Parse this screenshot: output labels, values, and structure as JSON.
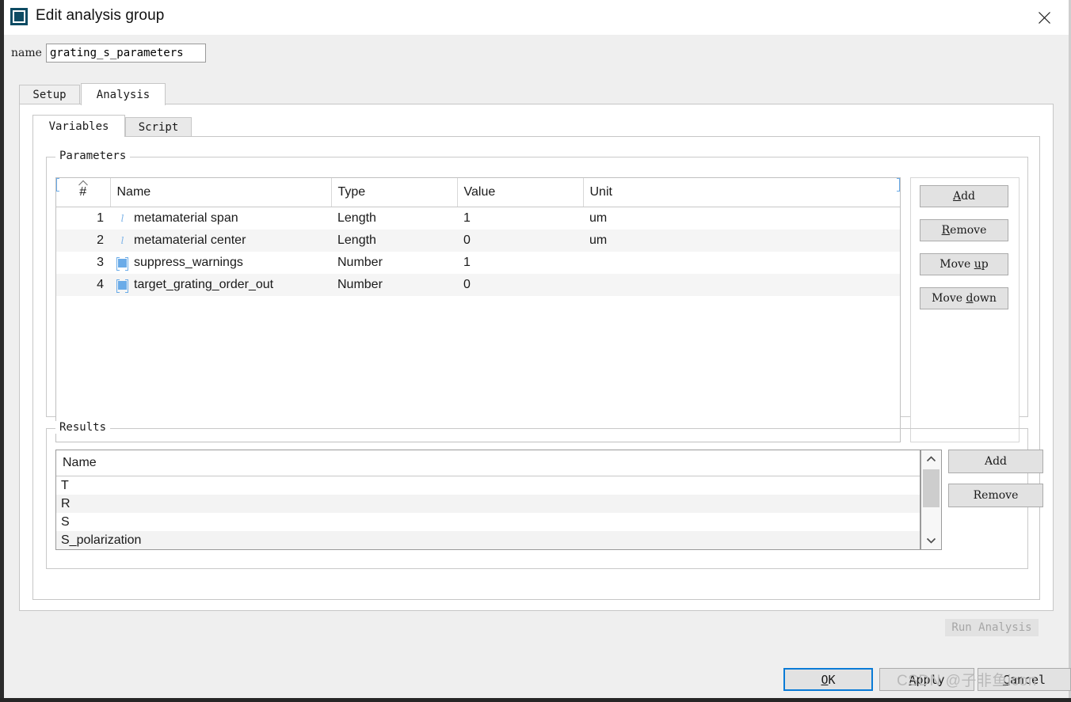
{
  "window": {
    "title": "Edit analysis group",
    "icon": "analysis-group-icon",
    "close_icon": "close-icon"
  },
  "name_field": {
    "label": "name",
    "value": "grating_s_parameters",
    "placeholder": ""
  },
  "tabs": [
    {
      "label": "Setup",
      "active": false
    },
    {
      "label": "Analysis",
      "active": true
    }
  ],
  "inner_tabs": [
    {
      "label": "Variables",
      "active": true
    },
    {
      "label": "Script",
      "active": false
    }
  ],
  "parameters": {
    "group_label": "Parameters",
    "columns": [
      "#",
      "Name",
      "Type",
      "Value",
      "Unit"
    ],
    "sort_indicator": "ascending",
    "rows": [
      {
        "num": "1",
        "icon": "length-variable-icon",
        "name": "metamaterial span",
        "type": "Length",
        "value": "1",
        "unit": "um"
      },
      {
        "num": "2",
        "icon": "length-variable-icon",
        "name": "metamaterial center",
        "type": "Length",
        "value": "0",
        "unit": "um"
      },
      {
        "num": "3",
        "icon": "number-variable-icon",
        "name": "suppress_warnings",
        "type": "Number",
        "value": "1",
        "unit": ""
      },
      {
        "num": "4",
        "icon": "number-variable-icon",
        "name": "target_grating_order_out",
        "type": "Number",
        "value": "0",
        "unit": ""
      }
    ],
    "buttons": [
      {
        "label": "Add",
        "mnemonic": "A"
      },
      {
        "label": "Remove",
        "mnemonic": "R"
      },
      {
        "label": "Move up",
        "mnemonic": "u"
      },
      {
        "label": "Move down",
        "mnemonic": "d"
      }
    ]
  },
  "results": {
    "group_label": "Results",
    "column": "Name",
    "rows": [
      "T",
      "R",
      "S",
      "S_polarization"
    ],
    "buttons": [
      {
        "label": "Add"
      },
      {
        "label": "Remove"
      }
    ],
    "scrollbar": {
      "up_icon": "chevron-up-icon",
      "down_icon": "chevron-down-icon"
    }
  },
  "run_analysis": {
    "label": "Run Analysis",
    "enabled": false
  },
  "dialog_buttons": [
    {
      "label": "OK",
      "mnemonic": "O",
      "default": true
    },
    {
      "label": "Apply",
      "mnemonic": "A",
      "default": false
    },
    {
      "label": "Cancel",
      "mnemonic": "C",
      "default": false
    }
  ],
  "watermark": "CSDN @子非鱼icon",
  "colors": {
    "accent": "#0a7bd6",
    "icon_blue": "#6aabe8",
    "title_icon": "#0d4b63",
    "panel": "#efefef"
  }
}
